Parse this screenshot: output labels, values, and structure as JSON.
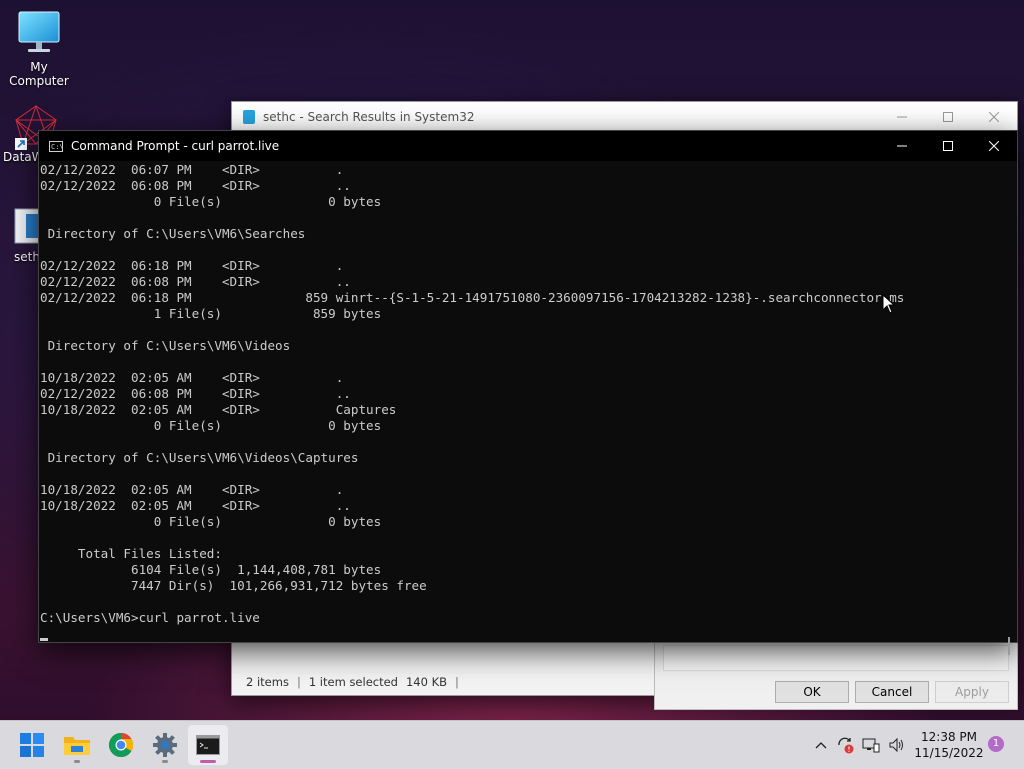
{
  "desktop": {
    "icons": [
      {
        "label": "My Computer",
        "icon": "monitor-icon"
      },
      {
        "label": "DataW",
        "icon": "datawrapper-icon"
      },
      {
        "label": "sethc",
        "icon": "file-icon"
      }
    ]
  },
  "explorer": {
    "title": "sethc - Search Results in System32",
    "status": {
      "items": "2 items",
      "selected": "1 item selected",
      "size": "140 KB",
      "sep": "|"
    }
  },
  "dialog": {
    "ok_label": "OK",
    "cancel_label": "Cancel",
    "apply_label": "Apply"
  },
  "cmd": {
    "title": "Command Prompt - curl  parrot.live",
    "icon_text": "C:\\",
    "lines": [
      "02/12/2022  06:07 PM    <DIR>          .",
      "02/12/2022  06:08 PM    <DIR>          ..",
      "               0 File(s)              0 bytes",
      "",
      " Directory of C:\\Users\\VM6\\Searches",
      "",
      "02/12/2022  06:18 PM    <DIR>          .",
      "02/12/2022  06:08 PM    <DIR>          ..",
      "02/12/2022  06:18 PM               859 winrt--{S-1-5-21-1491751080-2360097156-1704213282-1238}-.searchconnector-ms",
      "               1 File(s)            859 bytes",
      "",
      " Directory of C:\\Users\\VM6\\Videos",
      "",
      "10/18/2022  02:05 AM    <DIR>          .",
      "02/12/2022  06:08 PM    <DIR>          ..",
      "10/18/2022  02:05 AM    <DIR>          Captures",
      "               0 File(s)              0 bytes",
      "",
      " Directory of C:\\Users\\VM6\\Videos\\Captures",
      "",
      "10/18/2022  02:05 AM    <DIR>          .",
      "10/18/2022  02:05 AM    <DIR>          ..",
      "               0 File(s)              0 bytes",
      "",
      "     Total Files Listed:",
      "            6104 File(s)  1,144,408,781 bytes",
      "            7447 Dir(s)  101,266,931,712 bytes free",
      "",
      "C:\\Users\\VM6>curl parrot.live"
    ]
  },
  "taskbar": {
    "apps": [
      {
        "name": "start",
        "icon": "windows-start-icon"
      },
      {
        "name": "file-explorer",
        "icon": "folder-icon"
      },
      {
        "name": "chrome",
        "icon": "chrome-icon"
      },
      {
        "name": "settings",
        "icon": "gear-icon"
      },
      {
        "name": "command-prompt",
        "icon": "terminal-icon"
      }
    ],
    "clock": {
      "time": "12:38 PM",
      "date": "11/15/2022"
    },
    "notification_count": "1"
  },
  "colors": {
    "console_bg": "#0c0c0c",
    "console_text": "#cccccc",
    "taskbar_bg": "#d9d9de",
    "active_indicator": "#c05fa8"
  }
}
